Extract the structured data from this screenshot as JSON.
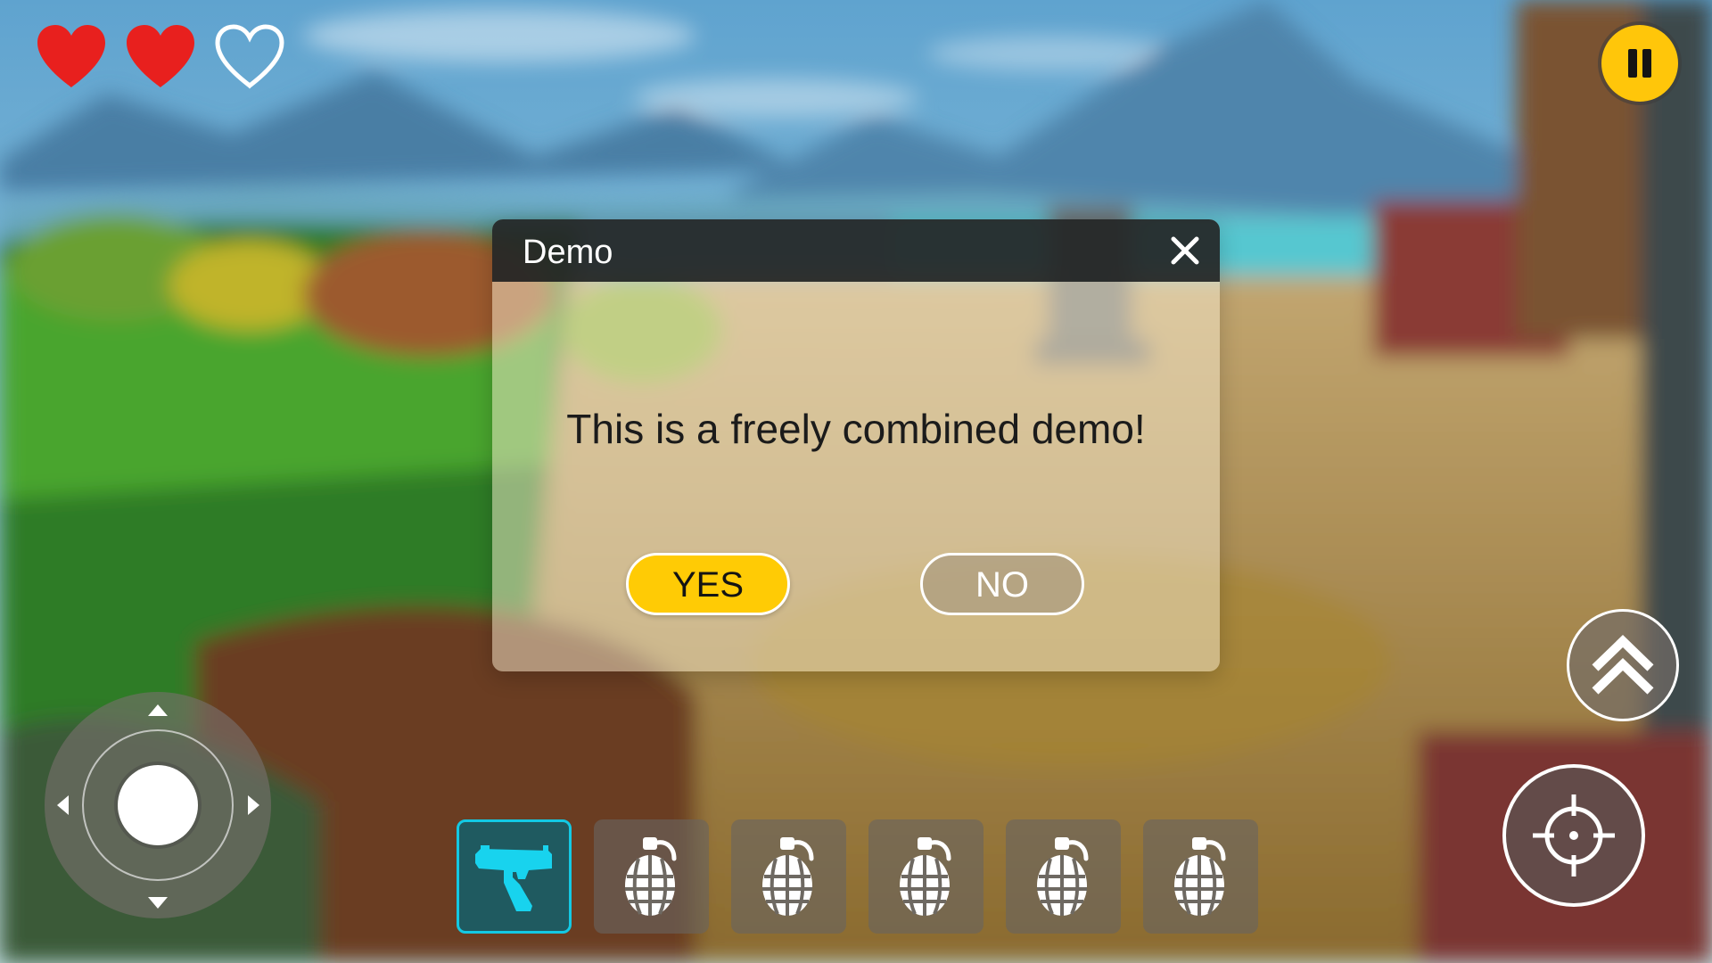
{
  "hud": {
    "hearts": [
      {
        "state": "full",
        "icon": "heart-full-icon"
      },
      {
        "state": "full",
        "icon": "heart-full-icon"
      },
      {
        "state": "empty",
        "icon": "heart-empty-icon"
      }
    ],
    "pause_icon": "pause-icon"
  },
  "dialog": {
    "title": "Demo",
    "message": "This is a freely combined demo!",
    "yes_label": "YES",
    "no_label": "NO",
    "close_icon": "close-icon"
  },
  "hotbar": {
    "selected_index": 0,
    "slots": [
      {
        "item": "pistol",
        "icon": "pistol-icon"
      },
      {
        "item": "grenade",
        "icon": "grenade-icon"
      },
      {
        "item": "grenade",
        "icon": "grenade-icon"
      },
      {
        "item": "grenade",
        "icon": "grenade-icon"
      },
      {
        "item": "grenade",
        "icon": "grenade-icon"
      },
      {
        "item": "grenade",
        "icon": "grenade-icon"
      }
    ]
  },
  "controls": {
    "joystick": "joystick",
    "jump_icon": "double-chevron-up-icon",
    "aim_icon": "crosshair-icon"
  },
  "colors": {
    "accent_yellow": "#ffcb05",
    "heart_red": "#e8201e",
    "selected_slot_border": "#13c9e4",
    "selected_slot_bg": "#1f5a60",
    "pistol_cyan": "#18d3ee"
  }
}
